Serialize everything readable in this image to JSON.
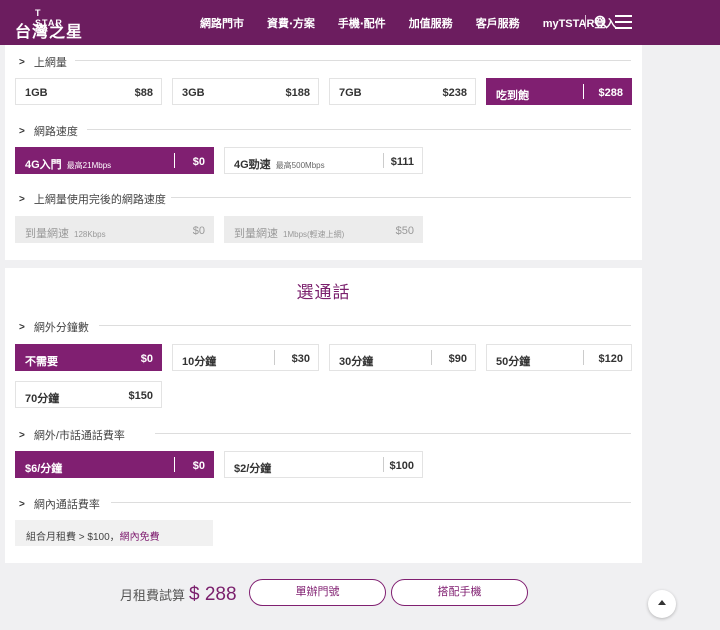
{
  "header": {
    "logo_en": "T STAR",
    "logo_zh": "台灣之星",
    "nav": [
      "網路門市",
      "資費‧方案",
      "手機‧配件",
      "加值服務",
      "客戶服務",
      "myTSTAR登入"
    ]
  },
  "data_section": {
    "label": "上網量",
    "options": [
      {
        "name": "1GB",
        "price": "$88"
      },
      {
        "name": "3GB",
        "price": "$188"
      },
      {
        "name": "7GB",
        "price": "$238"
      },
      {
        "name": "吃到飽",
        "price": "$288"
      }
    ]
  },
  "speed_section": {
    "label": "網路速度",
    "options": [
      {
        "name": "4G入門",
        "note": "最高21Mbps",
        "price": "$0"
      },
      {
        "name": "4G勁速",
        "note": "最高500Mbps",
        "price": "$111"
      }
    ]
  },
  "after_section": {
    "label": "上網量使用完後的網路速度",
    "options": [
      {
        "name": "到量網速",
        "note": "128Kbps",
        "price": "$0"
      },
      {
        "name": "到量網速",
        "note": "1Mbps(輕速上網)",
        "price": "$50"
      }
    ]
  },
  "voice": {
    "title": "選通話",
    "minutes_label": "網外分鐘數",
    "minutes": [
      {
        "name": "不需要",
        "price": "$0"
      },
      {
        "name": "10分鐘",
        "price": "$30"
      },
      {
        "name": "30分鐘",
        "price": "$90"
      },
      {
        "name": "50分鐘",
        "price": "$120"
      },
      {
        "name": "70分鐘",
        "price": "$150"
      }
    ],
    "rate_label": "網外/市話通話費率",
    "rates": [
      {
        "name": "$6/分鐘",
        "price": "$0"
      },
      {
        "name": "$2/分鐘",
        "price": "$100"
      }
    ],
    "onnet_label": "網內通話費率",
    "onnet_text": "組合月租費 > $100，",
    "onnet_highlight": "網內免費"
  },
  "footer": {
    "fee_label": "月租費試算",
    "fee_amount": "$ 288",
    "btn_number": "單辦門號",
    "btn_phone": "搭配手機"
  }
}
